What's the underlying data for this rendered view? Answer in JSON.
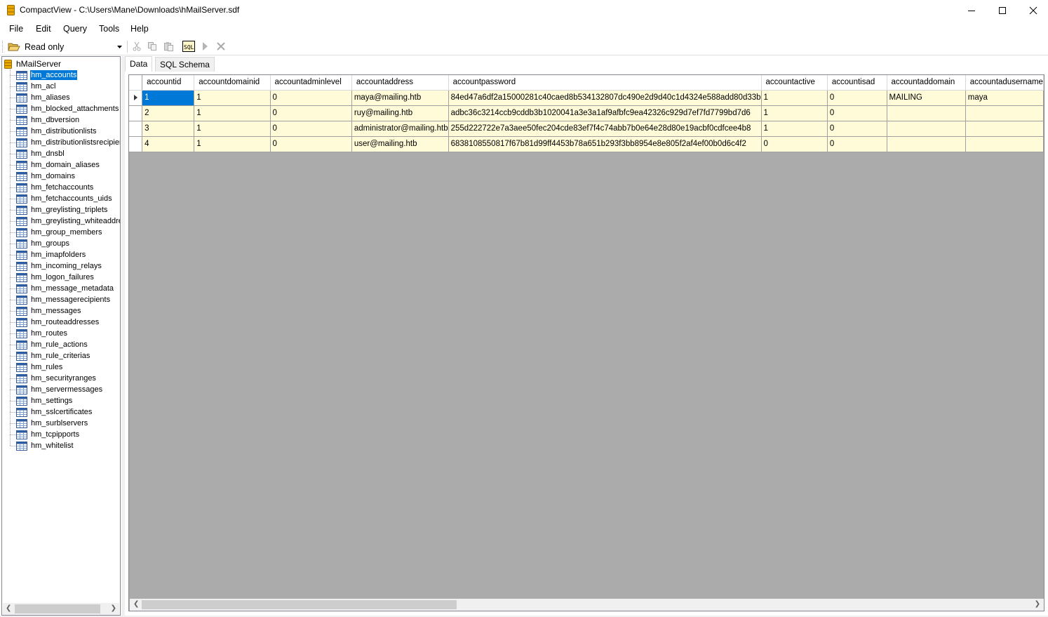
{
  "window": {
    "title": "CompactView - C:\\Users\\Mane\\Downloads\\hMailServer.sdf",
    "minimize_icon": "minimize-icon",
    "maximize_icon": "maximize-icon",
    "close_icon": "close-icon"
  },
  "menu": [
    "File",
    "Edit",
    "Query",
    "Tools",
    "Help"
  ],
  "toolbar": {
    "mode_value": "Read only",
    "buttons": [
      "cut-icon",
      "copy-icon",
      "paste-icon",
      "sql-icon",
      "run-icon",
      "cancel-icon"
    ],
    "sql_label": "SQL"
  },
  "tree": {
    "root": "hMailServer",
    "selected": "hm_accounts",
    "tables": [
      "hm_accounts",
      "hm_acl",
      "hm_aliases",
      "hm_blocked_attachments",
      "hm_dbversion",
      "hm_distributionlists",
      "hm_distributionlistsrecipient",
      "hm_dnsbl",
      "hm_domain_aliases",
      "hm_domains",
      "hm_fetchaccounts",
      "hm_fetchaccounts_uids",
      "hm_greylisting_triplets",
      "hm_greylisting_whiteaddres",
      "hm_group_members",
      "hm_groups",
      "hm_imapfolders",
      "hm_incoming_relays",
      "hm_logon_failures",
      "hm_message_metadata",
      "hm_messagerecipients",
      "hm_messages",
      "hm_routeaddresses",
      "hm_routes",
      "hm_rule_actions",
      "hm_rule_criterias",
      "hm_rules",
      "hm_securityranges",
      "hm_servermessages",
      "hm_settings",
      "hm_sslcertificates",
      "hm_surblservers",
      "hm_tcpipports",
      "hm_whitelist"
    ]
  },
  "tabs": [
    "Data",
    "SQL Schema"
  ],
  "grid": {
    "columns": [
      "accountid",
      "accountdomainid",
      "accountadminlevel",
      "accountaddress",
      "accountpassword",
      "accountactive",
      "accountisad",
      "accountaddomain",
      "accountadusername"
    ],
    "rows": [
      [
        "1",
        "1",
        "0",
        "maya@mailing.htb",
        "84ed47a6df2a15000281c40caed8b534132807dc490e2d9d40c1d4324e588add80d33b",
        "1",
        "0",
        "MAILING",
        "maya"
      ],
      [
        "2",
        "1",
        "0",
        "ruy@mailing.htb",
        "adbc36c3214ccb9cddb3b1020041a3e3a1af9afbfc9ea42326c929d7ef7fd7799bd7d6",
        "1",
        "0",
        "",
        ""
      ],
      [
        "3",
        "1",
        "0",
        "administrator@mailing.htb",
        "255d222722e7a3aee50fec204cde83ef7f4c74abb7b0e64e28d80e19acbf0cdfcee4b8",
        "1",
        "0",
        "",
        ""
      ],
      [
        "4",
        "1",
        "0",
        "user@mailing.htb",
        "6838108550817f67b81d99ff4453b78a651b293f3bb8954e8e805f2af4ef00b0d6c4f2",
        "0",
        "0",
        "",
        ""
      ]
    ]
  }
}
